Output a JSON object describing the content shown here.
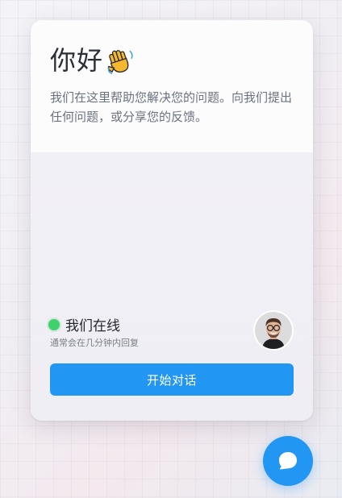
{
  "widget": {
    "greeting": "你好",
    "greeting_icon": "waving-hand-icon",
    "subtitle": "我们在这里帮助您解决您的问题。向我们提出任何问题，或分享您的反馈。",
    "status": {
      "label": "我们在线",
      "note": "通常会在几分钟内回复",
      "indicator_color": "#3fd16c"
    },
    "agent_avatar_icon": "agent-avatar",
    "cta_label": "开始对话"
  },
  "launcher": {
    "icon": "chat-bubble-icon"
  },
  "colors": {
    "accent": "#2196f3",
    "online": "#3fd16c",
    "text_primary": "#2b2f36",
    "text_secondary": "#6b7280"
  }
}
